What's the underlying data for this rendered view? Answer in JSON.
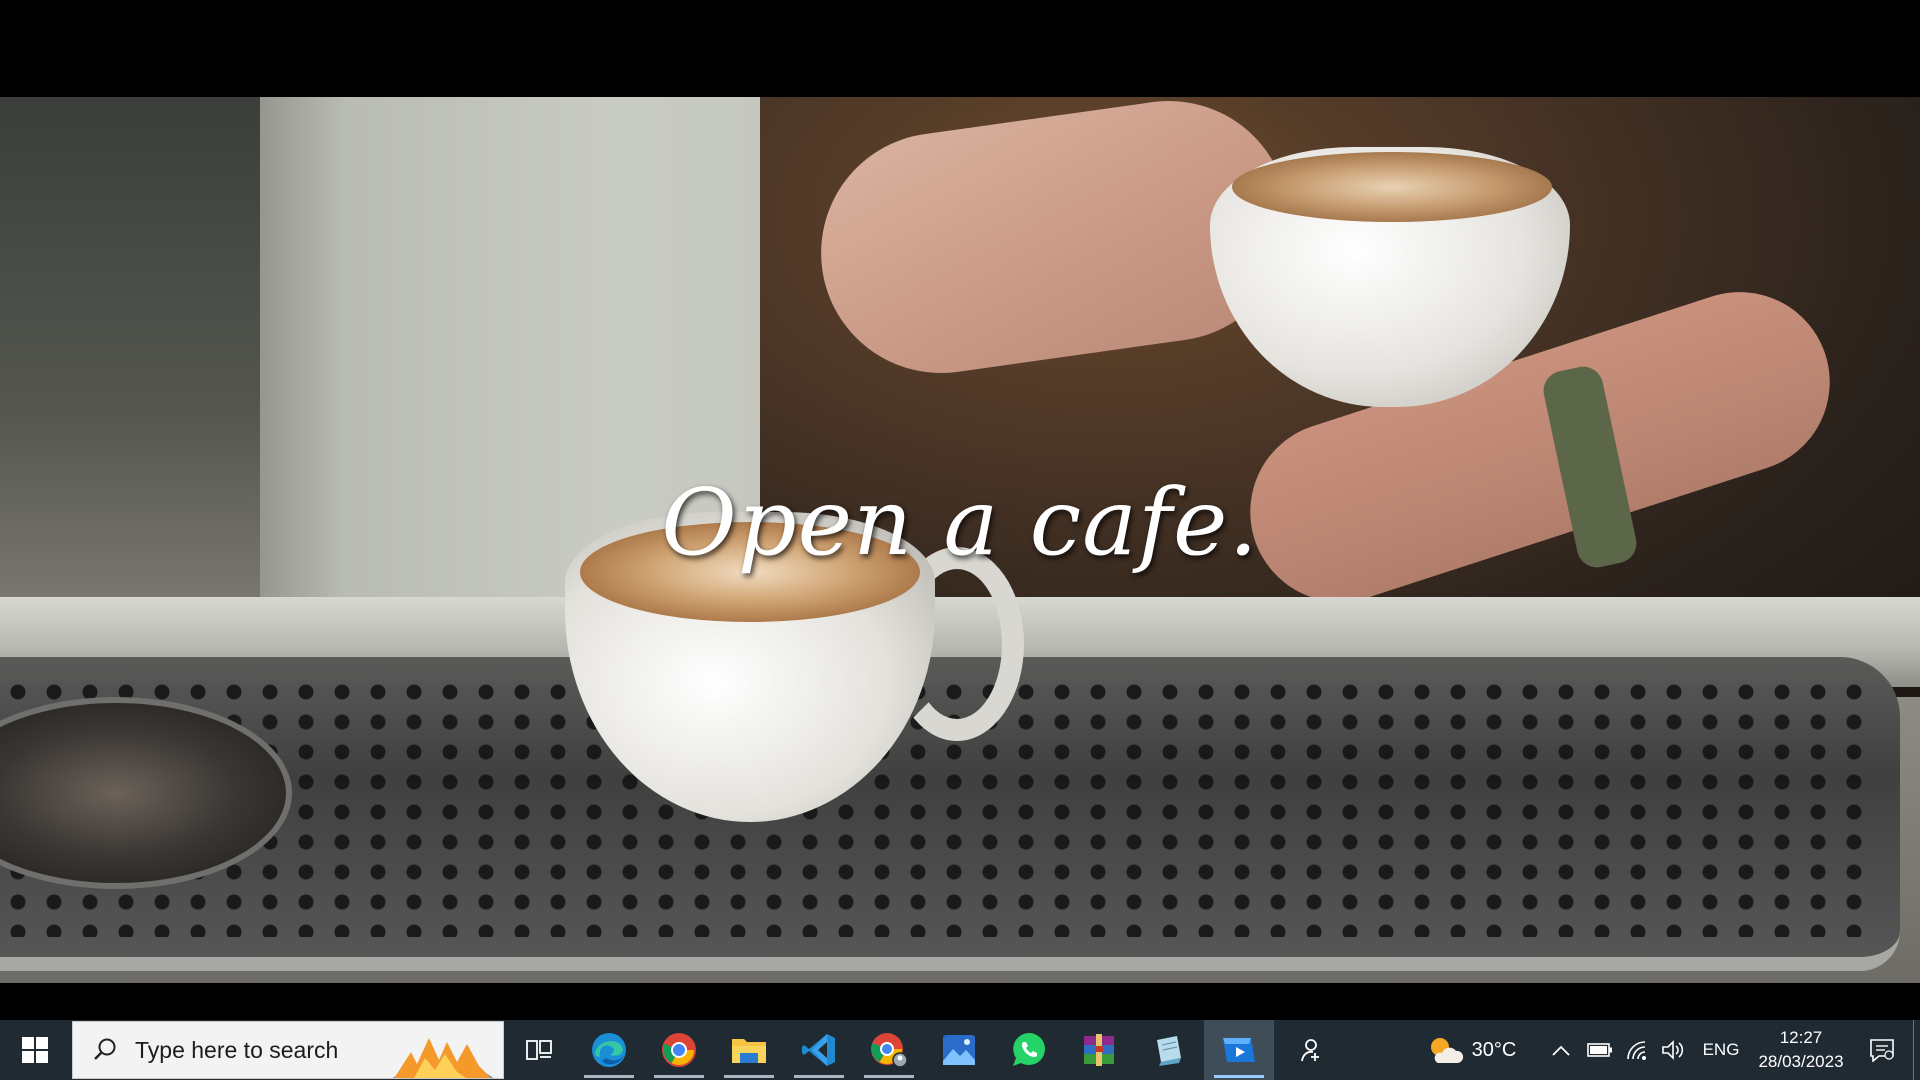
{
  "video": {
    "caption": "Open a cafe."
  },
  "taskbar": {
    "search": {
      "placeholder": "Type here to search"
    },
    "apps": [
      {
        "name": "task-view-icon"
      },
      {
        "name": "edge-icon"
      },
      {
        "name": "chrome-icon"
      },
      {
        "name": "file-explorer-icon"
      },
      {
        "name": "vscode-icon"
      },
      {
        "name": "chrome-profile-icon"
      },
      {
        "name": "photos-icon"
      },
      {
        "name": "whatsapp-icon"
      },
      {
        "name": "winrar-icon"
      },
      {
        "name": "notepad-icon"
      },
      {
        "name": "media-player-icon"
      }
    ],
    "weather": {
      "temperature": "30°C",
      "icon": "partly-sunny-icon"
    },
    "language": "ENG",
    "clock": {
      "time": "12:27",
      "date": "28/03/2023"
    }
  },
  "colors": {
    "taskbar_bg": "#1f2a33",
    "active_app_bg": "#3f4d58",
    "caption_text": "#ffffff"
  }
}
